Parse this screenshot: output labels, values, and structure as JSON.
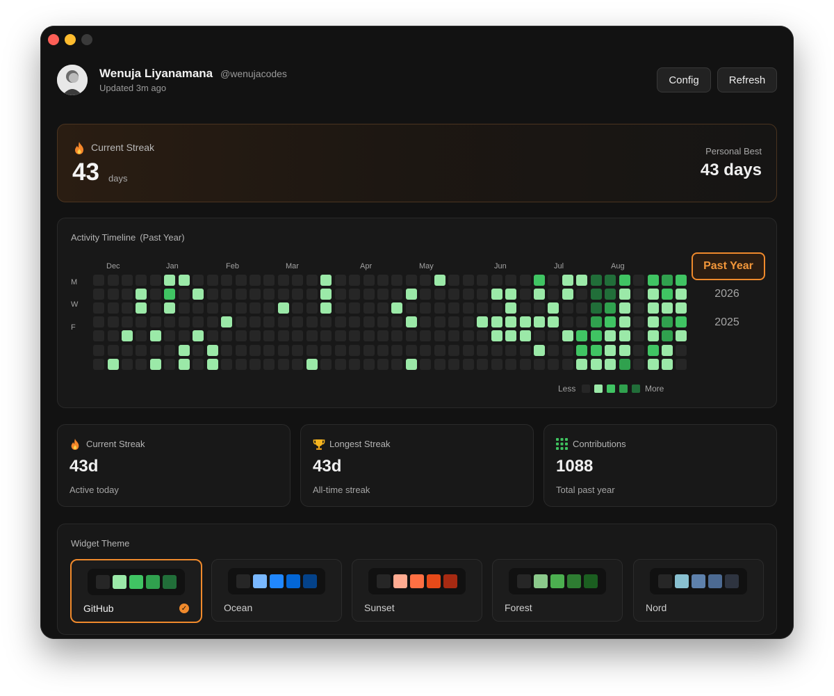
{
  "window": {
    "controls": [
      "close",
      "minimize",
      "maximize"
    ]
  },
  "header": {
    "name": "Wenuja Liyanamana",
    "handle": "@wenujacodes",
    "updated": "Updated 3m ago",
    "config_label": "Config",
    "refresh_label": "Refresh"
  },
  "streak": {
    "label": "Current Streak",
    "value": "43",
    "unit": "days",
    "best_label": "Personal Best",
    "best_value": "43 days",
    "icon": "flame-icon"
  },
  "activity": {
    "title": "Activity Timeline",
    "subtitle": "(Past Year)",
    "months": [
      "Dec",
      "Jan",
      "Feb",
      "Mar",
      "Apr",
      "May",
      "Jun",
      "Jul",
      "Aug"
    ],
    "days": [
      "M",
      "W",
      "F"
    ],
    "legend_less": "Less",
    "legend_more": "More",
    "colors": [
      "#262626",
      "#9be9a8",
      "#40c463",
      "#30a14e",
      "#216e39"
    ],
    "weeks": [
      [
        0,
        0,
        0,
        0,
        0,
        0,
        0
      ],
      [
        0,
        0,
        0,
        0,
        0,
        0,
        1
      ],
      [
        0,
        0,
        0,
        0,
        1,
        0,
        0
      ],
      [
        0,
        1,
        1,
        0,
        0,
        0,
        0
      ],
      [
        0,
        0,
        0,
        0,
        1,
        0,
        1
      ],
      [
        1,
        2,
        1,
        0,
        0,
        0,
        0
      ],
      [
        1,
        0,
        0,
        0,
        0,
        1,
        1
      ],
      [
        0,
        1,
        0,
        0,
        1,
        0,
        0
      ],
      [
        0,
        0,
        0,
        0,
        0,
        1,
        1
      ],
      [
        0,
        0,
        0,
        1,
        0,
        0,
        0
      ],
      [
        0,
        0,
        0,
        0,
        0,
        0,
        0
      ],
      [
        0,
        0,
        0,
        0,
        0,
        0,
        0
      ],
      [
        0,
        0,
        0,
        0,
        0,
        0,
        0
      ],
      [
        0,
        0,
        1,
        0,
        0,
        0,
        0
      ],
      [
        0,
        0,
        0,
        0,
        0,
        0,
        0
      ],
      [
        0,
        0,
        0,
        0,
        0,
        0,
        1
      ],
      [
        1,
        1,
        1,
        0,
        0,
        0,
        0
      ],
      [
        0,
        0,
        0,
        0,
        0,
        0,
        0
      ],
      [
        0,
        0,
        0,
        0,
        0,
        0,
        0
      ],
      [
        0,
        0,
        0,
        0,
        0,
        0,
        0
      ],
      [
        0,
        0,
        0,
        0,
        0,
        0,
        0
      ],
      [
        0,
        0,
        1,
        0,
        0,
        0,
        0
      ],
      [
        0,
        1,
        0,
        1,
        0,
        0,
        1
      ],
      [
        0,
        0,
        0,
        0,
        0,
        0,
        0
      ],
      [
        1,
        0,
        0,
        0,
        0,
        0,
        0
      ],
      [
        0,
        0,
        0,
        0,
        0,
        0,
        0
      ],
      [
        0,
        0,
        0,
        0,
        0,
        0,
        0
      ],
      [
        0,
        0,
        0,
        1,
        0,
        0,
        0
      ],
      [
        0,
        1,
        0,
        1,
        1,
        0,
        0
      ],
      [
        0,
        1,
        1,
        1,
        1,
        0,
        0
      ],
      [
        0,
        0,
        0,
        1,
        1,
        0,
        0
      ],
      [
        2,
        1,
        0,
        1,
        0,
        1,
        0
      ],
      [
        0,
        0,
        1,
        1,
        0,
        0,
        0
      ],
      [
        1,
        1,
        0,
        0,
        1,
        0,
        0
      ],
      [
        1,
        0,
        0,
        0,
        2,
        2,
        1
      ],
      [
        4,
        4,
        4,
        3,
        2,
        2,
        1
      ],
      [
        4,
        4,
        3,
        2,
        1,
        1,
        1
      ],
      [
        2,
        1,
        1,
        1,
        1,
        1,
        3
      ],
      [
        0,
        0,
        0,
        0,
        0,
        0,
        0
      ],
      [
        2,
        1,
        1,
        1,
        1,
        2,
        1
      ],
      [
        3,
        2,
        1,
        3,
        3,
        1,
        1
      ],
      [
        2,
        1,
        1,
        2,
        1,
        0,
        0
      ]
    ],
    "ranges": [
      "Past Year",
      "2026",
      "2025"
    ],
    "selected_range": "Past Year"
  },
  "stats": [
    {
      "label": "Current Streak",
      "value": "43d",
      "desc": "Active today",
      "icon": "flame-icon"
    },
    {
      "label": "Longest Streak",
      "value": "43d",
      "desc": "All-time streak",
      "icon": "trophy-icon"
    },
    {
      "label": "Contributions",
      "value": "1088",
      "desc": "Total past year",
      "icon": "grid-icon"
    }
  ],
  "themes": {
    "title": "Widget Theme",
    "selected": "GitHub",
    "items": [
      {
        "name": "GitHub",
        "colors": [
          "#262626",
          "#9be9a8",
          "#40c463",
          "#30a14e",
          "#216e39"
        ]
      },
      {
        "name": "Ocean",
        "colors": [
          "#262626",
          "#79b8ff",
          "#2188ff",
          "#0366d6",
          "#044289"
        ]
      },
      {
        "name": "Sunset",
        "colors": [
          "#262626",
          "#ffab91",
          "#ff7043",
          "#e64a19",
          "#a62a12"
        ]
      },
      {
        "name": "Forest",
        "colors": [
          "#262626",
          "#8bc98b",
          "#4caf50",
          "#2e7d32",
          "#1b5e20"
        ]
      },
      {
        "name": "Nord",
        "colors": [
          "#262626",
          "#88c0d0",
          "#5e81ac",
          "#4c6a92",
          "#2e3440"
        ]
      }
    ]
  },
  "accent": "#f08a2c"
}
